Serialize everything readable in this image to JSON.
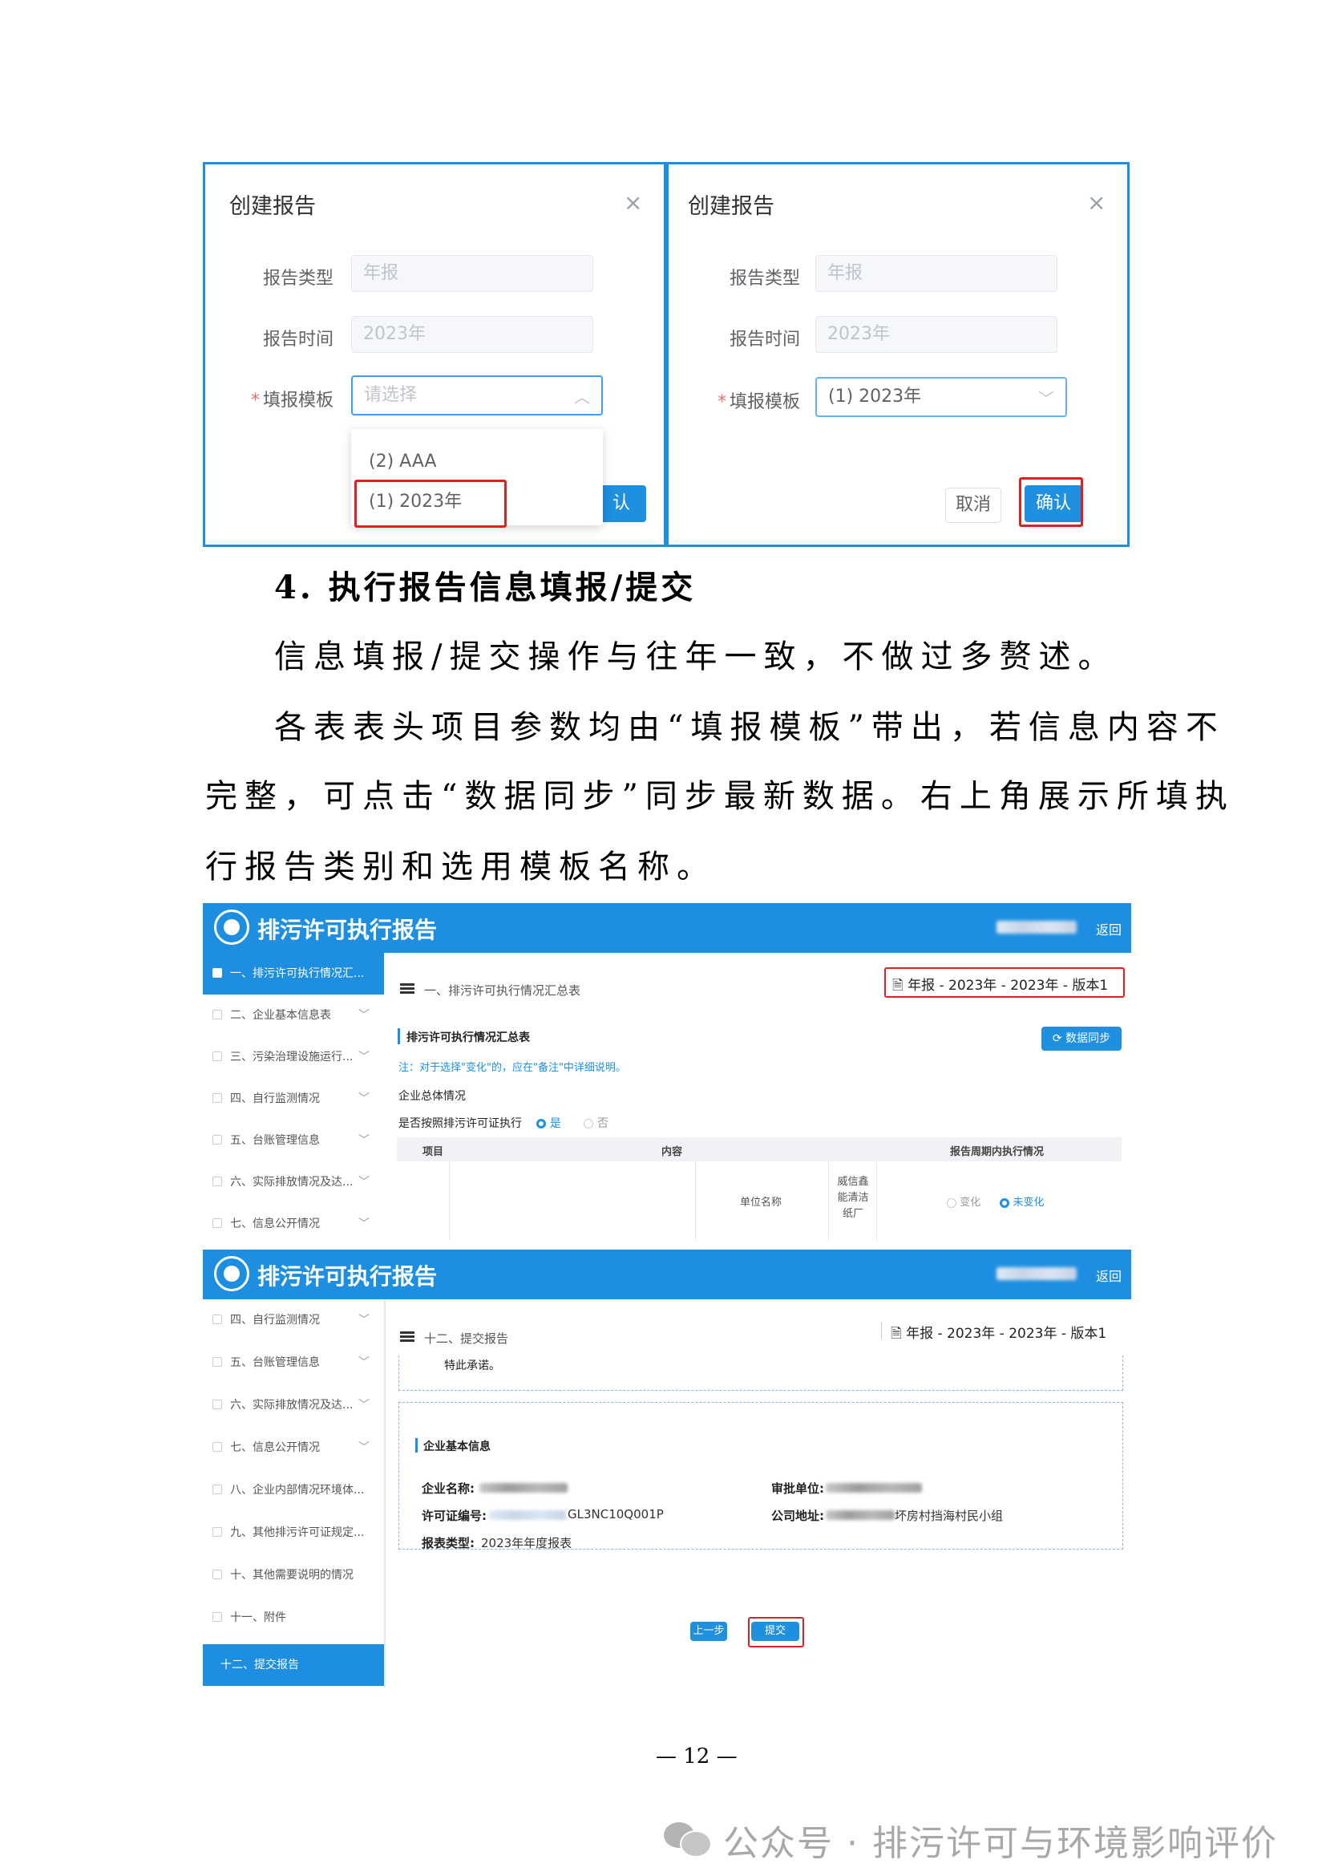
{
  "dialogs": {
    "title": "创建报告",
    "label_type": "报告类型",
    "label_time": "报告时间",
    "label_template": "填报模板",
    "required_mark": "*",
    "value_type": "年报",
    "value_time": "2023年",
    "left_placeholder": "请选择",
    "dropdown_options": [
      "(2) AAA",
      "(1) 2023年"
    ],
    "left_partial_confirm": "认",
    "right_selected": "(1) 2023年",
    "cancel_label": "取消",
    "confirm_label": "确认"
  },
  "heading": "4. 执行报告信息填报/提交",
  "paragraphs": [
    "信息填报/提交操作与往年一致，不做过多赘述。",
    "各表表头项目参数均由“填报模板”带出，若信息内容不",
    "完整，可点击“数据同步”同步最新数据。右上角展示所填执",
    "行报告类别和选用模板名称。"
  ],
  "app": {
    "title": "排污许可执行报告",
    "back_label": "返回"
  },
  "screen1": {
    "sidebar": [
      "一、排污许可执行情况汇...",
      "二、企业基本信息表",
      "三、污染治理设施运行...",
      "四、自行监测情况",
      "五、台账管理信息",
      "六、实际排放情况及达...",
      "七、信息公开情况"
    ],
    "section_title": "一、排污许可执行情况汇总表",
    "report_tag": "年报 - 2023年  -  2023年 - 版本1",
    "table_title": "排污许可执行情况汇总表",
    "sync_button": "数据同步",
    "note": "注：对于选择\"变化\"的，应在\"备注\"中详细说明。",
    "overall_label": "企业总体情况",
    "question": "是否按照排污许可证执行",
    "yes": "是",
    "no": "否",
    "col_item": "项目",
    "col_content": "内容",
    "col_period": "报告周期内执行情况",
    "unit_name_label": "单位名称",
    "unit_name_value": "威信鑫能清洁纸厂",
    "changed": "变化",
    "unchanged": "未变化"
  },
  "screen2": {
    "sidebar": [
      "四、自行监测情况",
      "五、台账管理信息",
      "六、实际排放情况及达...",
      "七、信息公开情况",
      "八、企业内部情况环境体...",
      "九、其他排污许可证规定...",
      "十、其他需要说明的情况",
      "十一、附件",
      "十二、提交报告"
    ],
    "section_title": "十二、提交报告",
    "report_tag": "年报 - 2023年  -  2023年 - 版本1",
    "promise": "特此承诺。",
    "info_title": "企业基本信息",
    "company_name_label": "企业名称:",
    "approval_unit_label": "审批单位:",
    "license_no_label": "许可证编号:",
    "license_no_value": "GL3NC10Q001P",
    "address_label": "公司地址:",
    "address_value": "坏房村挡海村民小组",
    "report_type_label": "报表类型:",
    "report_type_value": "2023年年度报表",
    "prev_button": "上一步",
    "submit_button": "提交"
  },
  "page_number": "— 12 —",
  "watermark": "公众号 · 排污许可与环境影响评价",
  "colors": {
    "primary_blue": "#1e8fe0",
    "highlight_red": "#e02020"
  }
}
